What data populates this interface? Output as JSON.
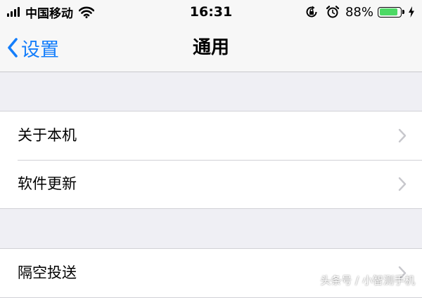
{
  "status_bar": {
    "carrier": "中国移动",
    "time": "16:31",
    "battery_percent": "88%",
    "battery_level": 0.88,
    "battery_color": "#4cd964",
    "icons": [
      "signal-icon",
      "wifi-icon",
      "rotation-lock-icon",
      "alarm-icon",
      "battery-icon",
      "charging-icon"
    ]
  },
  "nav": {
    "back_label": "设置",
    "title": "通用",
    "accent_color": "#147efb"
  },
  "sections": [
    {
      "items": [
        {
          "label": "关于本机"
        },
        {
          "label": "软件更新"
        }
      ]
    },
    {
      "items": [
        {
          "label": "隔空投送"
        }
      ]
    }
  ],
  "watermark": "头条号 / 小智测手机"
}
